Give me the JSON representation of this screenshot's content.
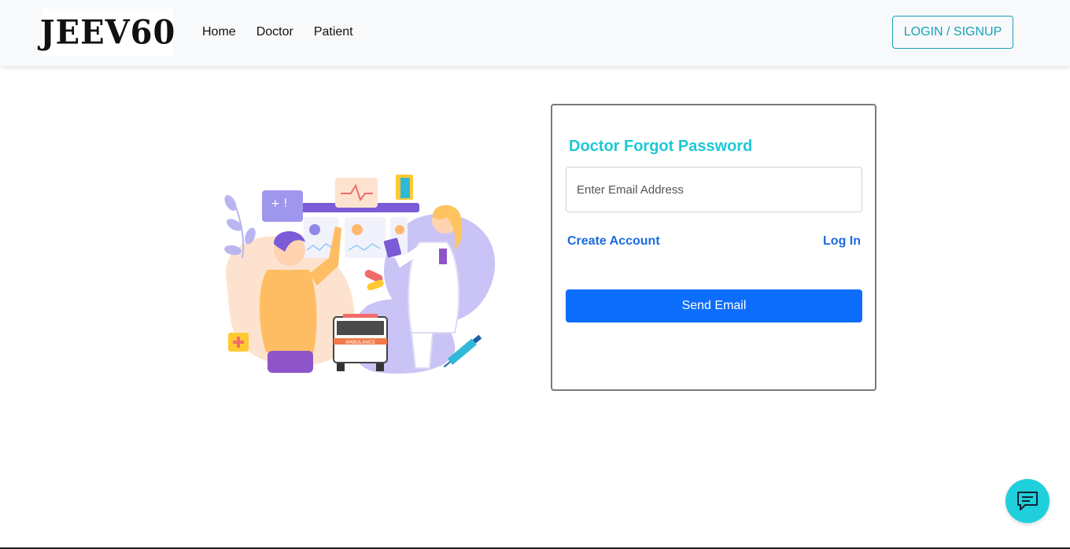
{
  "brand": {
    "logo_text": "JEEV60"
  },
  "nav": {
    "links": [
      {
        "label": "Home"
      },
      {
        "label": "Doctor"
      },
      {
        "label": "Patient"
      }
    ],
    "auth_button": "LOGIN / SIGNUP"
  },
  "form": {
    "title": "Doctor Forgot Password",
    "email_placeholder": "Enter Email Address",
    "email_value": "",
    "create_account_label": "Create Account",
    "login_label": "Log In",
    "submit_label": "Send Email"
  },
  "illustration": {
    "ambulance_text": "AMBULANCE"
  },
  "colors": {
    "accent_teal": "#17a2b8",
    "title_cyan": "#1ec8d6",
    "primary_blue": "#0d6efd",
    "link_blue": "#1a6be0",
    "chat_bubble": "#1fd0dc"
  },
  "icons": {
    "chat": "chat-icon"
  }
}
